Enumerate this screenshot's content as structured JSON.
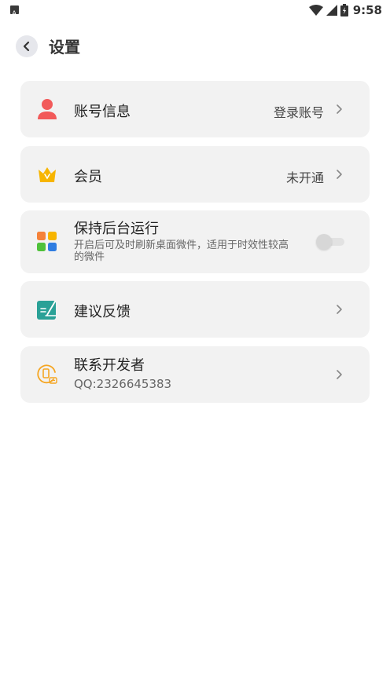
{
  "status_bar": {
    "time": "9:58",
    "icons": [
      "notification-icon",
      "wifi-icon",
      "signal-icon",
      "battery-icon"
    ]
  },
  "header": {
    "title": "设置",
    "back_icon": "chevron-left-icon"
  },
  "items": [
    {
      "title": "账号信息",
      "value": "登录账号",
      "icon": "user-icon",
      "icon_color": "#f25a5a"
    },
    {
      "title": "会员",
      "value": "未开通",
      "icon": "crown-icon",
      "icon_color": "#f7b500"
    },
    {
      "title": "保持后台运行",
      "subtitle": "开启后可及时刷新桌面微件，适用于时效性较高的微件",
      "icon": "widgets-icon",
      "toggle": false
    },
    {
      "title": "建议反馈",
      "icon": "feedback-icon",
      "icon_color": "#2aa197"
    },
    {
      "title": "联系开发者",
      "subtitle": "QQ:2326645383",
      "icon": "contact-developer-icon",
      "icon_color": "#f5a623"
    }
  ],
  "colors": {
    "card_bg": "#f2f2f2",
    "page_bg": "#ffffff",
    "text_primary": "#222222",
    "text_secondary": "#666666"
  }
}
